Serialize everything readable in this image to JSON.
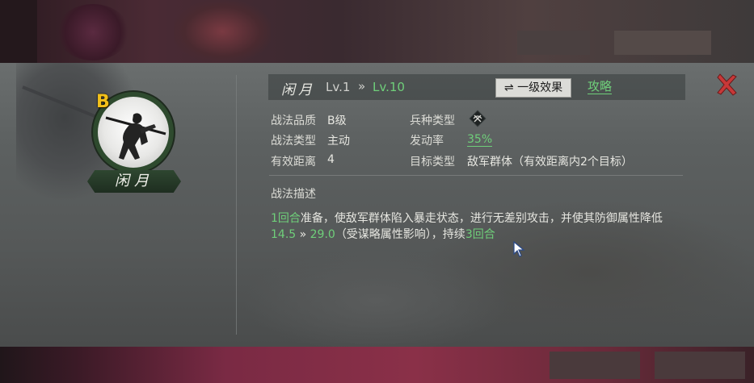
{
  "skill": {
    "grade": "B",
    "name": "闲月",
    "level_current": "Lv.1",
    "level_arrow": "»",
    "level_max": "Lv.10"
  },
  "header": {
    "effect_button_icon": "⇌",
    "effect_button_label": "一级效果",
    "guide_label": "攻略",
    "close_icon": "close-x-icon"
  },
  "attributes": {
    "quality_label": "战法品质",
    "quality_value": "B级",
    "troop_label": "兵种类型",
    "troop_icon": "crossbow-icon",
    "type_label": "战法类型",
    "type_value": "主动",
    "rate_label": "发动率",
    "rate_value": "35%",
    "range_label": "有效距离",
    "range_value": "4",
    "target_label": "目标类型",
    "target_value": "敌军群体（有效距离内2个目标）"
  },
  "description": {
    "title": "战法描述",
    "line1_g1": "1回合",
    "line1_t1": "准备，使敌军群体陷入暴走状态，进行无差别攻击，并使其防御属性降低",
    "line2_g1": "14.5",
    "line2_arrow": " » ",
    "line2_g2": "29.0",
    "line2_t1": "（受谋略属性影响），持续",
    "line2_g3": "3回合"
  },
  "colors": {
    "accent_green": "#6fcf7a",
    "grade_gold": "#f2c01a",
    "close_red": "#c83838"
  }
}
